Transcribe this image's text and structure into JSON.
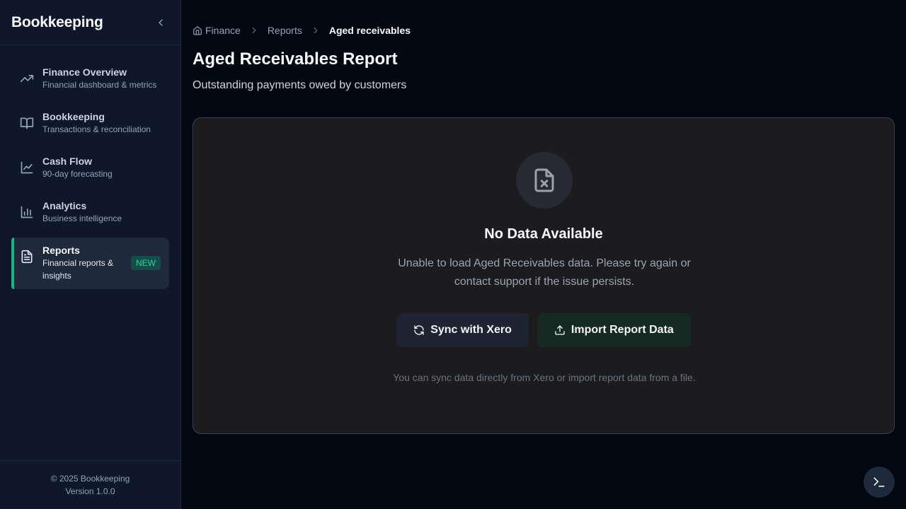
{
  "sidebar": {
    "brand": "Bookkeeping",
    "items": [
      {
        "title": "Finance Overview",
        "subtitle": "Financial dashboard & metrics",
        "icon": "trending-up-icon"
      },
      {
        "title": "Bookkeeping",
        "subtitle": "Transactions & reconciliation",
        "icon": "book-open-icon"
      },
      {
        "title": "Cash Flow",
        "subtitle": "90-day forecasting",
        "icon": "line-chart-icon"
      },
      {
        "title": "Analytics",
        "subtitle": "Business intelligence",
        "icon": "bar-chart-icon"
      },
      {
        "title": "Reports",
        "subtitle": "Financial reports & insights",
        "icon": "file-text-icon",
        "badge": "NEW",
        "active": true
      }
    ],
    "footer": {
      "copyright": "© 2025 Bookkeeping",
      "version": "Version 1.0.0"
    }
  },
  "breadcrumb": {
    "home": "Finance",
    "section": "Reports",
    "current": "Aged receivables"
  },
  "page": {
    "title": "Aged Receivables Report",
    "subtitle": "Outstanding payments owed by customers"
  },
  "empty_state": {
    "icon": "file-x-icon",
    "title": "No Data Available",
    "description": "Unable to load Aged Receivables data. Please try again or contact support if the issue persists.",
    "sync_label": "Sync with Xero",
    "import_label": "Import Report Data",
    "hint": "You can sync data directly from Xero or import report data from a file."
  },
  "colors": {
    "accent": "#10b981",
    "background": "#030712",
    "sidebar": "#0f172a"
  }
}
